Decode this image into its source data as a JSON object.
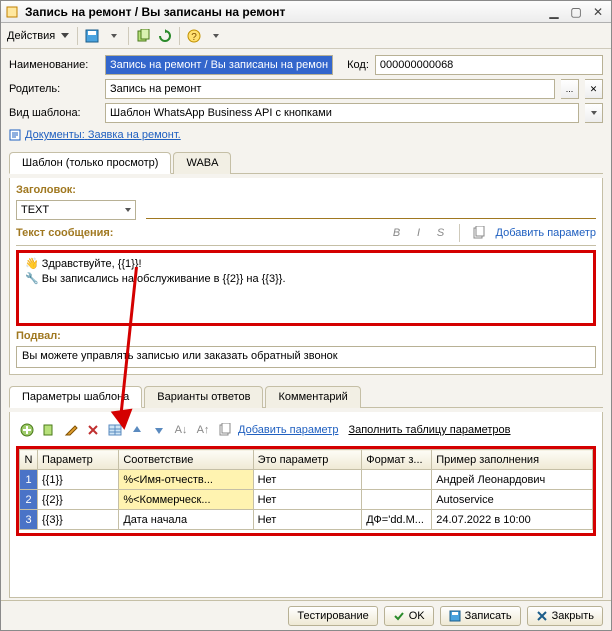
{
  "window": {
    "title": "Запись на ремонт / Вы записаны на ремонт"
  },
  "toolbar": {
    "actions_label": "Действия"
  },
  "form": {
    "name_label": "Наименование:",
    "name_value": "Запись на ремонт / Вы записаны на ремонт",
    "code_label": "Код:",
    "code_value": "000000000068",
    "parent_label": "Родитель:",
    "parent_value": "Запись на ремонт",
    "template_kind_label": "Вид шаблона:",
    "template_kind_value": "Шаблон WhatsApp Business API с кнопками",
    "doc_prefix": "Документы:",
    "doc_link": "Заявка на ремонт."
  },
  "tabs_top": {
    "t1": "Шаблон (только просмотр)",
    "t2": "WABA"
  },
  "template_panel": {
    "header_label": "Заголовок:",
    "type_value": "TEXT",
    "msg_label": "Текст сообщения:",
    "fmt_b": "B",
    "fmt_i": "I",
    "fmt_s": "S",
    "add_param": "Добавить параметр",
    "msg_line1": "Здравствуйте, {{1}}!",
    "msg_line2": "Вы записались на обслуживание в {{2}} на {{3}}.",
    "footer_label": "Подвал:",
    "footer_value": "Вы можете управлять записью или заказать обратный звонок"
  },
  "tabs_mid": {
    "t1": "Параметры шаблона",
    "t2": "Варианты ответов",
    "t3": "Комментарий"
  },
  "param_tools": {
    "add": "Добавить параметр",
    "fill": "Заполнить таблицу параметров"
  },
  "table": {
    "hN": "N",
    "h1": "Параметр",
    "h2": "Соответствие",
    "h3": "Это параметр",
    "h4": "Формат з...",
    "h5": "Пример заполнения",
    "rows": [
      {
        "n": "1",
        "param": "{{1}}",
        "corr": "%<Имя-отчеств...",
        "isp": "Нет",
        "fmt": "",
        "ex": "Андрей Леонардович"
      },
      {
        "n": "2",
        "param": "{{2}}",
        "corr": "%<Коммерческ...",
        "isp": "Нет",
        "fmt": "",
        "ex": "Autoservice"
      },
      {
        "n": "3",
        "param": "{{3}}",
        "corr": "Дата начала",
        "isp": "Нет",
        "fmt": "ДФ='dd.M...",
        "ex": "24.07.2022 в 10:00"
      }
    ]
  },
  "statusbar": {
    "test": "Тестирование",
    "ok": "OK",
    "save": "Записать",
    "close": "Закрыть"
  }
}
